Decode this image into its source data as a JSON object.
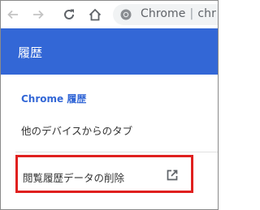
{
  "toolbar": {
    "omnibox": {
      "site_name": "Chrome",
      "separator": "|",
      "url_fragment": "chr"
    },
    "icons": {
      "back": "arrow-left-icon",
      "forward": "arrow-right-icon",
      "reload": "reload-icon",
      "home": "home-icon",
      "site": "chrome-site-icon"
    }
  },
  "header": {
    "title": "履歴",
    "background": "#3367d6"
  },
  "sidebar": {
    "items": [
      {
        "label": "Chrome 履歴",
        "selected": true
      },
      {
        "label": "他のデバイスからのタブ"
      },
      {
        "label": "閲覧履歴データの削除",
        "icon": "open-in-new-icon"
      }
    ]
  },
  "colors": {
    "accent": "#3367d6",
    "highlight_border": "#e0201f"
  }
}
